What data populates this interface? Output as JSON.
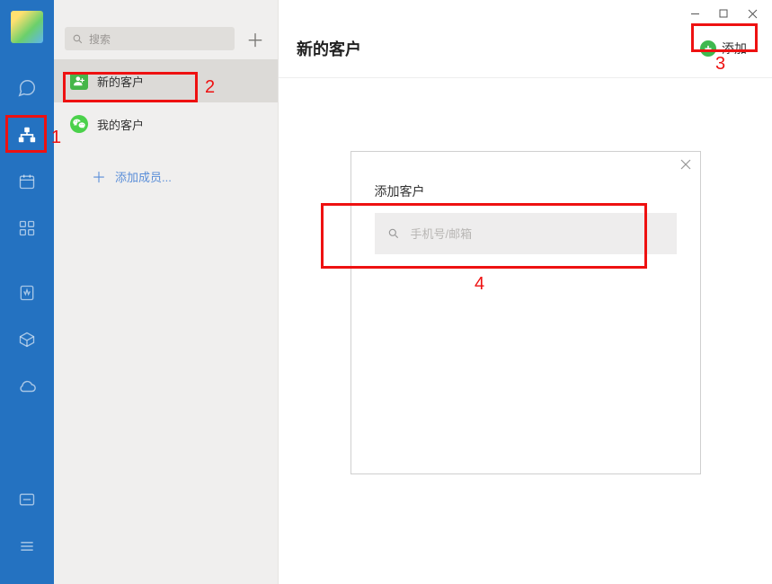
{
  "search": {
    "placeholder": "搜索"
  },
  "sidebar": {
    "items": [
      {
        "label": "新的客户"
      },
      {
        "label": "我的客户"
      }
    ],
    "add_member_label": "添加成员..."
  },
  "header": {
    "title": "新的客户",
    "add_label": "添加"
  },
  "modal": {
    "title": "添加客户",
    "placeholder": "手机号/邮箱"
  },
  "annotations": {
    "a1": "1",
    "a2": "2",
    "a3": "3",
    "a4": "4"
  }
}
